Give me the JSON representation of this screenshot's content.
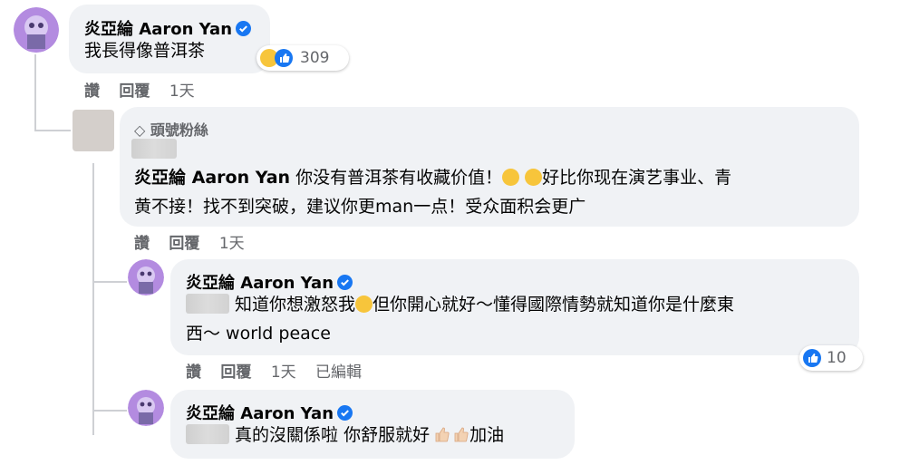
{
  "comments": [
    {
      "author": "炎亞綸 Aaron Yan",
      "text": "我長得像普洱茶",
      "reaction_count": "309",
      "actions": {
        "like": "讚",
        "reply": "回覆",
        "time": "1天"
      }
    },
    {
      "badge": "頭號粉絲",
      "mention": "炎亞綸 Aaron Yan",
      "text_line1": " 你没有普洱茶有收藏价值！",
      "text_line1b": "好比你现在演艺事业、青",
      "text_line2": "黄不接！找不到突破，建议你更man一点！受众面积会更广",
      "actions": {
        "like": "讚",
        "reply": "回覆",
        "time": "1天"
      }
    },
    {
      "author": "炎亞綸 Aaron Yan",
      "text_line1": " 知道你想激怒我",
      "text_line1b": "但你開心就好～懂得國際情勢就知道你是什麼東",
      "text_line2": "西～ world peace",
      "reaction_count": "10",
      "actions": {
        "like": "讚",
        "reply": "回覆",
        "time": "1天",
        "edited": "已編輯"
      }
    },
    {
      "author": "炎亞綸 Aaron Yan",
      "text": " 真的沒關係啦 你舒服就好",
      "text_end": "加油"
    }
  ],
  "colors": {
    "bubble": "#f0f2f5",
    "verified": "#1877f2",
    "meta": "#65676b"
  }
}
